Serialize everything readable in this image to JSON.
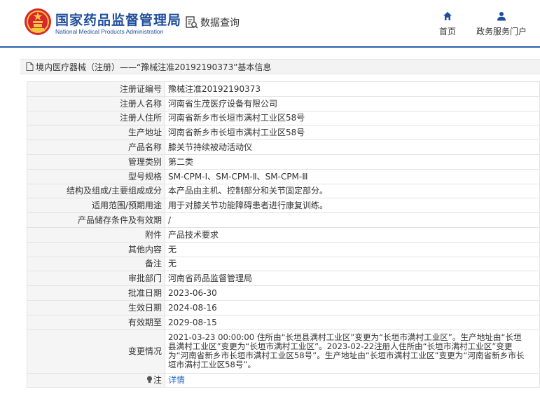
{
  "header": {
    "org_cn": "国家药品监督管理局",
    "org_en": "National Medical Products Administration",
    "search_label": "数据查询",
    "nav": [
      {
        "label": "首页",
        "icon": "home-icon"
      },
      {
        "label": "政务服务门户",
        "icon": "user-icon"
      }
    ]
  },
  "breadcrumb": {
    "text": "境内医疗器械（注册）——“豫械注准20192190373”基本信息"
  },
  "rows": [
    {
      "label": "注册证编号",
      "value": "豫械注准20192190373"
    },
    {
      "label": "注册人名称",
      "value": "河南省生茂医疗设备有限公司"
    },
    {
      "label": "注册人住所",
      "value": "河南省新乡市长垣市满村工业区58号"
    },
    {
      "label": "生产地址",
      "value": "河南省新乡市长垣市满村工业区58号"
    },
    {
      "label": "产品名称",
      "value": "膝关节持续被动活动仪"
    },
    {
      "label": "管理类别",
      "value": "第二类"
    },
    {
      "label": "型号规格",
      "value": "SM-CPM-Ⅰ、SM-CPM-Ⅱ、SM-CPM-Ⅲ"
    },
    {
      "label": "结构及组成/主要组成成分",
      "value": "本产品由主机、控制部分和关节固定部分。"
    },
    {
      "label": "适用范围/预期用途",
      "value": "用于对膝关节功能障碍患者进行康复训练。"
    },
    {
      "label": "产品储存条件及有效期",
      "value": "/"
    },
    {
      "label": "附件",
      "value": "产品技术要求"
    },
    {
      "label": "其他内容",
      "value": "无"
    },
    {
      "label": "备注",
      "value": "无"
    },
    {
      "label": "审批部门",
      "value": "河南省药品监督管理局"
    },
    {
      "label": "批准日期",
      "value": "2023-06-30"
    },
    {
      "label": "生效日期",
      "value": "2024-08-16"
    },
    {
      "label": "有效期至",
      "value": "2029-08-15"
    },
    {
      "label": "变更情况",
      "value": "2021-03-23 00:00:00 住所由“长垣县满村工业区”变更为“长垣市满村工业区”。生产地址由“长垣县满村工业区”变更为“长垣市满村工业区”。2023-02-22注册人住所由“长垣市满村工业区”变更为“河南省新乡市长垣市满村工业区58号”。生产地址由“长垣市满村工业区”变更为“河南省新乡市长垣市满村工业区58号”。"
    }
  ],
  "note": {
    "label": "注",
    "link_text": "详情"
  }
}
